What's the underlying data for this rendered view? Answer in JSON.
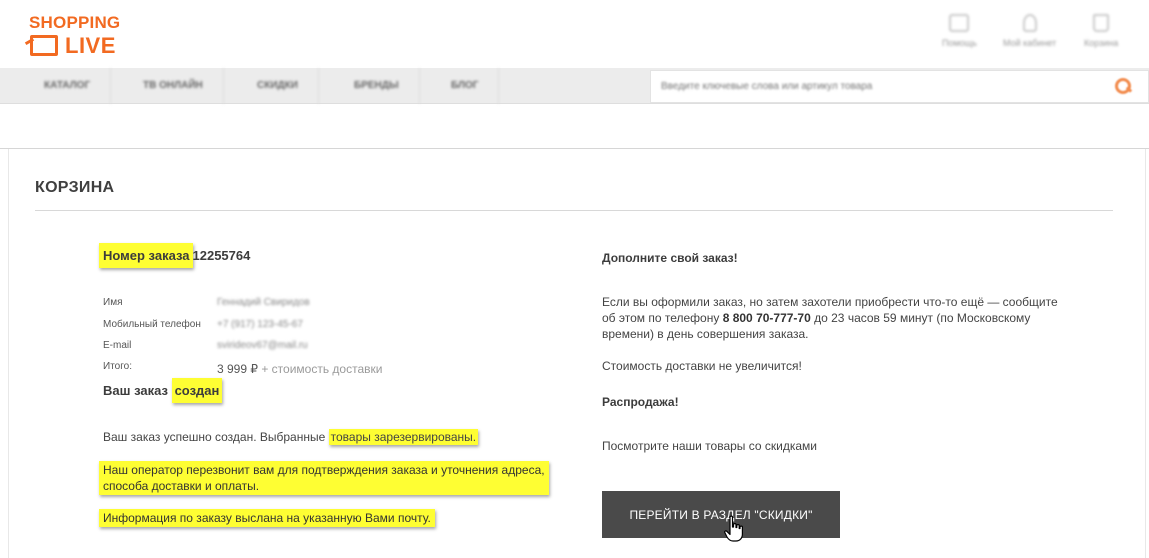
{
  "brand": {
    "logo_top": "SHOPPING",
    "logo_bottom": "LIVE",
    "accent": "#f26a21"
  },
  "header_icons": [
    {
      "icon": "chat-icon",
      "label": "Помощь"
    },
    {
      "icon": "user-icon",
      "label": "Мой кабинет"
    },
    {
      "icon": "cart-icon",
      "label": "Корзина"
    }
  ],
  "nav": {
    "items": [
      "Каталог",
      "ТВ онлайн",
      "Скидки",
      "Бренды",
      "Блог"
    ],
    "search_placeholder": "Введите ключевые слова или артикул товара"
  },
  "page": {
    "title": "КОРЗИНА"
  },
  "order": {
    "number_label": "Номер заказа",
    "number": "12255764",
    "fields": [
      {
        "label": "Имя",
        "value": "Геннадий Свиридов"
      },
      {
        "label": "Мобильный телефон",
        "value": "+7 (917) 123-45-67"
      },
      {
        "label": "E-mail",
        "value": "svirideov67@mail.ru"
      }
    ],
    "total_label": "Итого:",
    "total_value": "3 999 ₽",
    "total_extra": "+ стоимость доставки",
    "status_prefix": "Ваш заказ",
    "status_word": "создан",
    "message1_prefix": "Ваш заказ успешно создан. Выбранные",
    "message1_highlight": "товары зарезервированы.",
    "message2_line1": "Наш оператор перезвонит вам для подтверждения заказа и уточнения адреса,",
    "message2_line2": "способа доставки и оплаты.",
    "message3": "Информация по заказу выслана на указанную Вами почту."
  },
  "sidebar": {
    "heading1": "Дополните свой заказ!",
    "text1_line1": "Если вы оформили заказ, но затем захотели приобрести что-то ещё — сообщите",
    "text1_line2_prefix": "об этом по телефону",
    "phone": "8 800 70-777-70",
    "text1_line2_suffix": "до 23 часов 59 минут (по Московскому",
    "text1_line3": "времени) в день совершения заказа.",
    "text2": "Стоимость доставки не увеличится!",
    "heading2": "Распродажа!",
    "text3": "Посмотрите наши товары со скидками",
    "button_label": "ПЕРЕЙТИ В РАЗДЕЛ \"СКИДКИ\""
  }
}
